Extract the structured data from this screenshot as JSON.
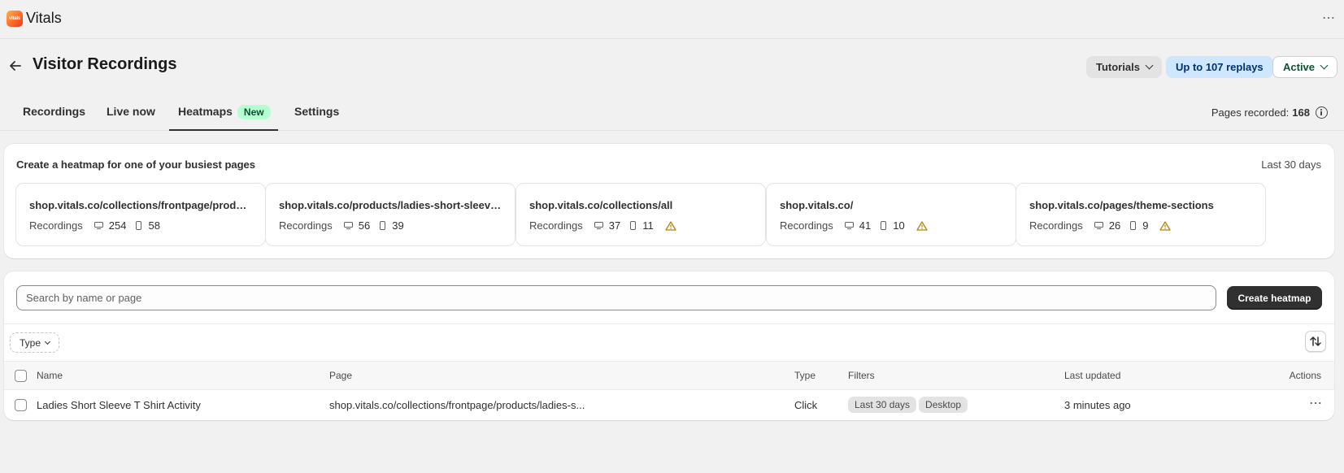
{
  "app": {
    "logo_text": "vitals",
    "title": "Vitals"
  },
  "header": {
    "title": "Visitor Recordings",
    "tutorials_label": "Tutorials",
    "replays_label": "Up to 107 replays",
    "status_label": "Active"
  },
  "tabs": [
    {
      "label": "Recordings"
    },
    {
      "label": "Live now"
    },
    {
      "label": "Heatmaps",
      "badge": "New",
      "selected": true
    },
    {
      "label": "Settings"
    }
  ],
  "pages_recorded": {
    "label": "Pages recorded:",
    "value": "168"
  },
  "busiest": {
    "title": "Create a heatmap for one of your busiest pages",
    "range": "Last 30 days",
    "pages": [
      {
        "url": "shop.vitals.co/collections/frontpage/products/ladies-short-sleeve-t-shirt",
        "label": "Recordings",
        "desktop": "254",
        "mobile": "58",
        "warning": false
      },
      {
        "url": "shop.vitals.co/products/ladies-short-sleeve-t-shirt",
        "label": "Recordings",
        "desktop": "56",
        "mobile": "39",
        "warning": false
      },
      {
        "url": "shop.vitals.co/collections/all",
        "label": "Recordings",
        "desktop": "37",
        "mobile": "11",
        "warning": true
      },
      {
        "url": "shop.vitals.co/",
        "label": "Recordings",
        "desktop": "41",
        "mobile": "10",
        "warning": true
      },
      {
        "url": "shop.vitals.co/pages/theme-sections",
        "label": "Recordings",
        "desktop": "26",
        "mobile": "9",
        "warning": true
      }
    ]
  },
  "heatmaps": {
    "search_placeholder": "Search by name or page",
    "create_label": "Create heatmap",
    "type_filter_label": "Type",
    "columns": {
      "name": "Name",
      "page": "Page",
      "type": "Type",
      "filters": "Filters",
      "last_updated": "Last updated",
      "actions": "Actions"
    },
    "rows": [
      {
        "name": "Ladies Short Sleeve T Shirt Activity",
        "page": "shop.vitals.co/collections/frontpage/products/ladies-s...",
        "type": "Click",
        "filters": [
          "Last 30 days",
          "Desktop"
        ],
        "last_updated": "3 minutes ago"
      }
    ]
  },
  "colors": {
    "accent_dark": "#303030",
    "replays_bg": "#cfe6ff",
    "new_badge_bg": "#b4fed2",
    "warning": "#b28400"
  }
}
